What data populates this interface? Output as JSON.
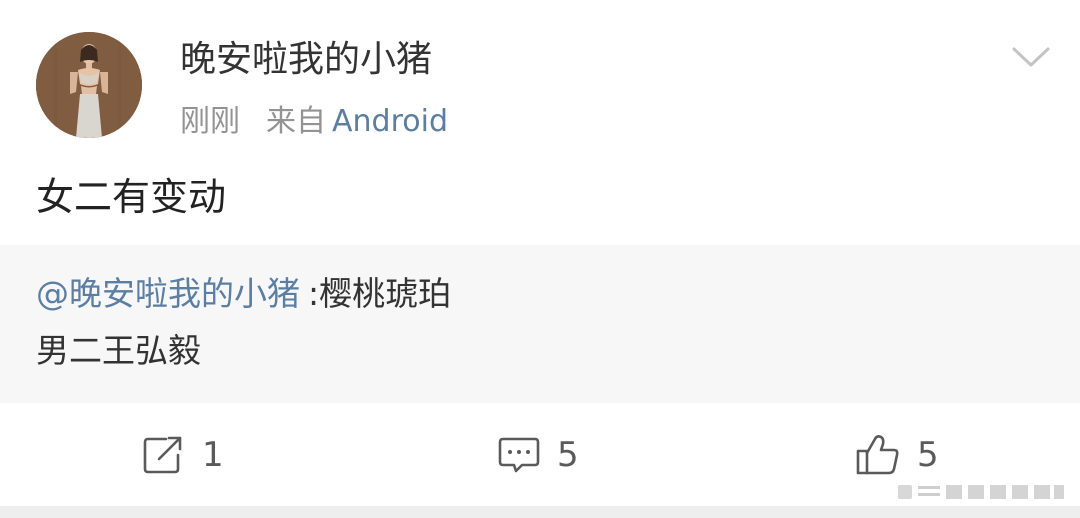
{
  "post": {
    "author": {
      "name": "晚安啦我的小猪",
      "time": "刚刚",
      "from_label": "来自",
      "source": "Android"
    },
    "text": "女二有变动",
    "repost": {
      "mention": "@晚安啦我的小猪",
      "title": ":樱桃琥珀",
      "body": "男二王弘毅"
    },
    "actions": {
      "repost_count": "1",
      "comment_count": "5",
      "like_count": "5"
    }
  },
  "colors": {
    "link": "#5b7ea5",
    "meta_gray": "#939393",
    "repost_bg": "#f7f7f7"
  },
  "icons": {
    "menu": "chevron-down-icon",
    "repost": "share-arrow-icon",
    "comment": "comment-bubble-icon",
    "like": "thumbs-up-icon"
  }
}
